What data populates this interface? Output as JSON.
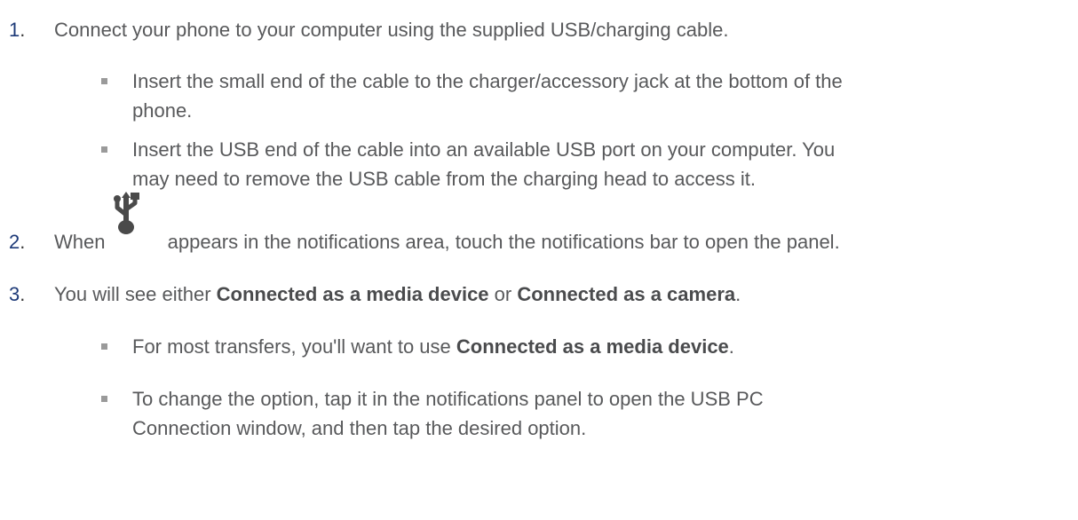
{
  "steps": [
    {
      "number": "1",
      "text": "Connect your phone to your computer using the supplied USB/charging cable.",
      "substeps": [
        {
          "line1": "Insert the small end of the cable to the charger/accessory jack at the bottom of the",
          "line2": "phone."
        },
        {
          "line1": "Insert the USB end of the cable into an available USB port on your computer. You",
          "line2": "may need to remove the USB cable from the charging head to access it."
        }
      ]
    },
    {
      "number": "2",
      "text_before": "When",
      "icon": "usb-icon",
      "text_after": "appears in the notifications area, touch the notifications bar to open the panel."
    },
    {
      "number": "3",
      "text_before": "You will see either ",
      "bold1": "Connected as a media device",
      "text_mid": " or ",
      "bold2": "Connected as a camera",
      "text_after": ".",
      "substeps": [
        {
          "text_before": "For most transfers, you'll want to use ",
          "bold": "Connected as a media device",
          "text_after": "."
        },
        {
          "line1": "To change the option, tap it in the notifications panel to open the USB PC",
          "line2": "Connection window, and then tap the desired option."
        }
      ]
    }
  ],
  "colors": {
    "number": "#1d3a78",
    "text": "#58595b",
    "bullet": "#9a9a9a"
  }
}
